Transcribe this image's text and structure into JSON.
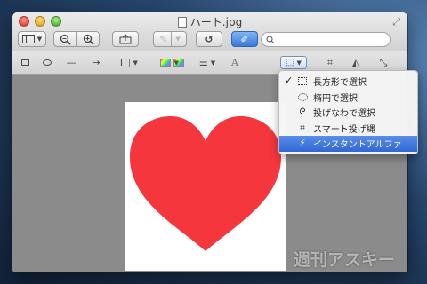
{
  "window": {
    "title": "ハート.jpg"
  },
  "toolbar": {
    "search_placeholder": ""
  },
  "menu": {
    "items": [
      {
        "label": "長方形で選択",
        "checked": true,
        "icon": "rectangle-select-icon"
      },
      {
        "label": "楕円で選択",
        "checked": false,
        "icon": "ellipse-select-icon"
      },
      {
        "label": "投げなわで選択",
        "checked": false,
        "icon": "lasso-select-icon"
      },
      {
        "label": "スマート投げ縄",
        "checked": false,
        "icon": "smart-lasso-icon"
      },
      {
        "label": "インスタントアルファ",
        "checked": false,
        "highlighted": true,
        "icon": "magic-wand-icon"
      }
    ]
  },
  "image": {
    "heart_color": "#f5363c"
  },
  "watermark": {
    "text": "週刊アスキー"
  }
}
